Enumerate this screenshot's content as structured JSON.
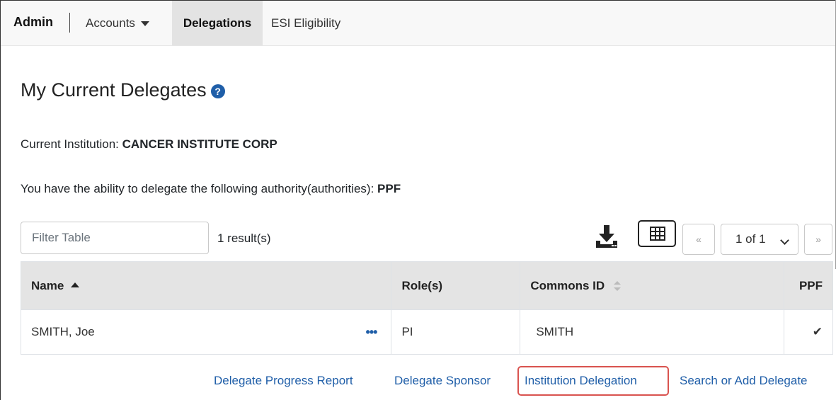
{
  "nav": {
    "brand": "Admin",
    "accounts_label": "Accounts",
    "delegations_label": "Delegations",
    "esi_label": "ESI Eligibility"
  },
  "page": {
    "title": "My Current Delegates",
    "help_icon": "question-circle-icon",
    "institution_label": "Current Institution:",
    "institution_value": "CANCER INSTITUTE CORP",
    "authority_label": "You have the ability to delegate the following authority(authorities):",
    "authority_value": "PPF"
  },
  "toolbar": {
    "filter_placeholder": "Filter Table",
    "results": "1 result(s)",
    "download_icon": "download-icon",
    "grid_icon": "table-grid-icon",
    "prev_label": "«",
    "page_select_value": "1 of 1",
    "next_label": "»"
  },
  "table": {
    "headers": {
      "name": "Name",
      "roles": "Role(s)",
      "commons_id": "Commons ID",
      "ppf": "PPF"
    },
    "rows": [
      {
        "name": "SMITH, Joe",
        "actions": "•••",
        "role": "PI",
        "commons_id": "SMITH",
        "ppf": "✔"
      }
    ]
  },
  "links": {
    "progress_report": "Delegate Progress Report",
    "sponsor": "Delegate Sponsor",
    "institution": "Institution Delegation",
    "search_add": "Search or Add Delegate"
  },
  "colors": {
    "link": "#1f5ea8",
    "highlight": "#d9534f",
    "header_bg": "#e4e4e4"
  }
}
